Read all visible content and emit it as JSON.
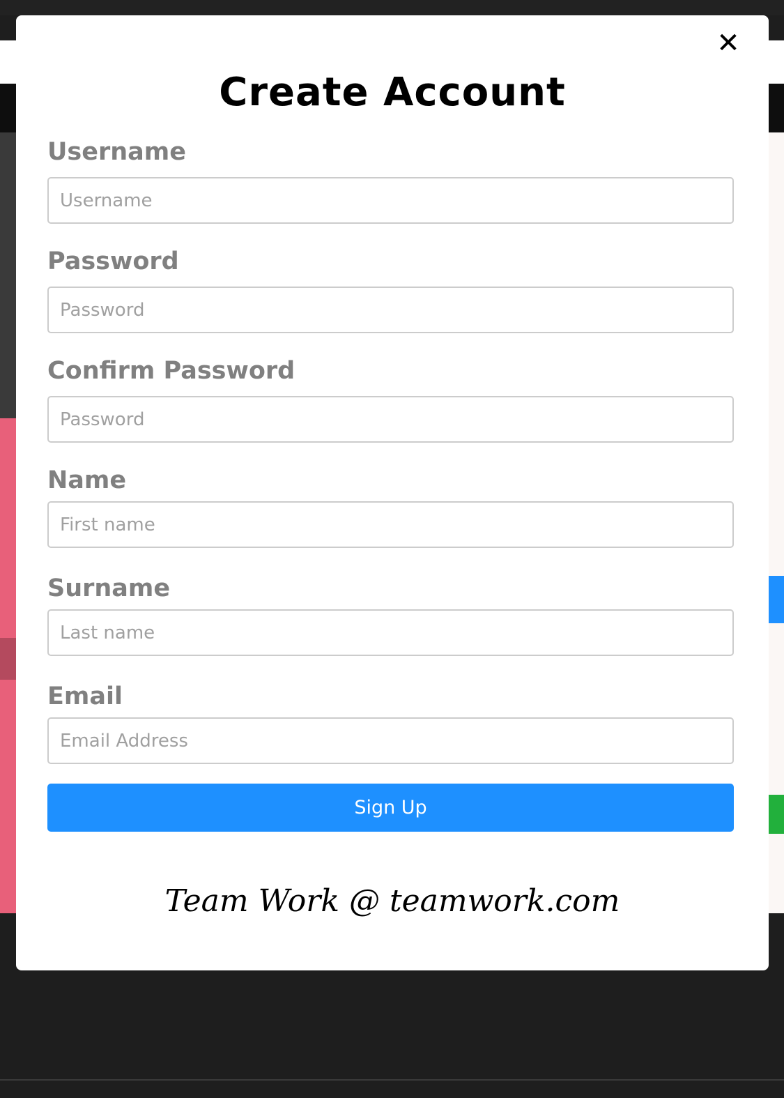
{
  "modal": {
    "title": "Create Account",
    "close_icon": "close-icon",
    "close_glyph": "✕",
    "fields": [
      {
        "label": "Username",
        "placeholder": "Username",
        "type": "text"
      },
      {
        "label": "Password",
        "placeholder": "Password",
        "type": "password"
      },
      {
        "label": "Confirm Password",
        "placeholder": "Password",
        "type": "password"
      },
      {
        "label": "Name",
        "placeholder": "First name",
        "type": "text"
      },
      {
        "label": "Surname",
        "placeholder": "Last name",
        "type": "text"
      },
      {
        "label": "Email",
        "placeholder": "Email Address",
        "type": "email"
      }
    ],
    "submit_label": "Sign Up",
    "footer_text": "Team Work @ teamwork.com"
  },
  "colors": {
    "accent": "#1e90ff",
    "label": "#808080",
    "backdrop": "#1e1e1e"
  }
}
